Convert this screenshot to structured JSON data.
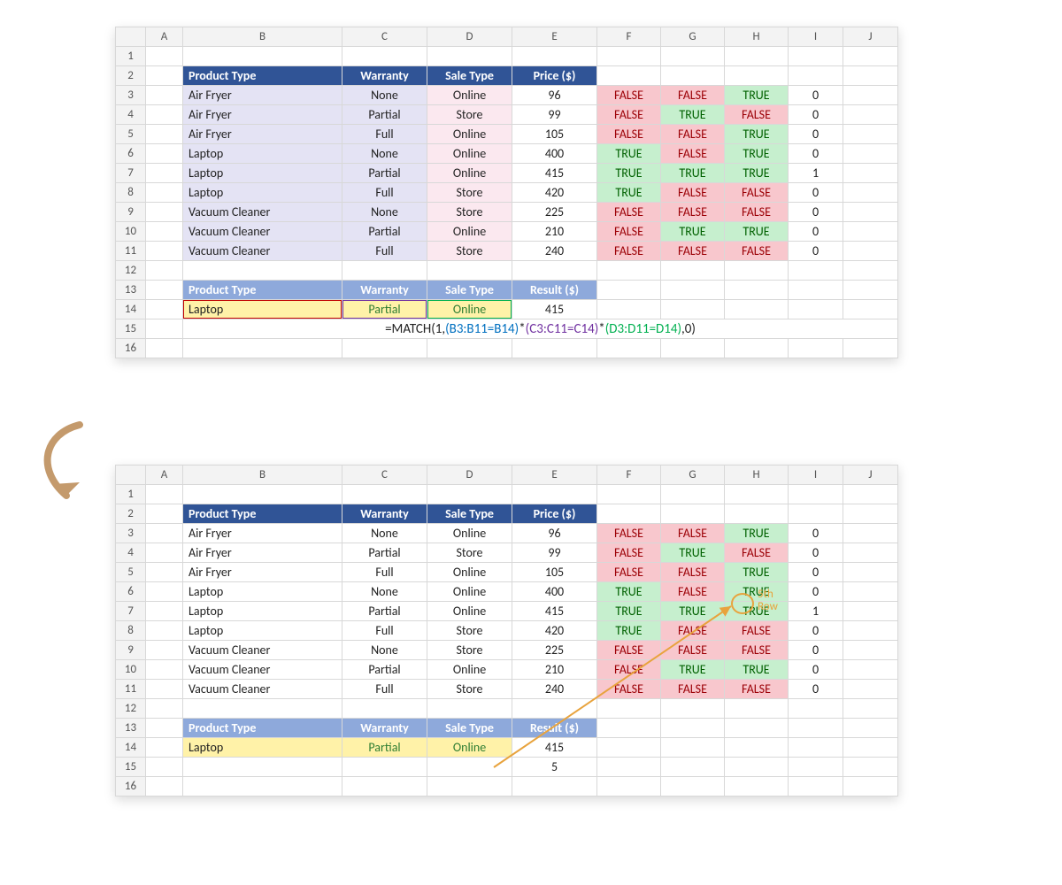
{
  "columns": [
    "A",
    "B",
    "C",
    "D",
    "E",
    "F",
    "G",
    "H",
    "I",
    "J"
  ],
  "rownums": [
    "1",
    "2",
    "3",
    "4",
    "5",
    "6",
    "7",
    "8",
    "9",
    "10",
    "11",
    "12",
    "13",
    "14",
    "15",
    "16"
  ],
  "headers": {
    "product": "Product Type",
    "warranty": "Warranty",
    "sale": "Sale Type",
    "price": "Price ($)",
    "result": "Result ($)"
  },
  "rows": [
    {
      "product": "Air Fryer",
      "warranty": "None",
      "sale": "Online",
      "price": "96",
      "f": "FALSE",
      "g": "FALSE",
      "h": "TRUE",
      "i": "0"
    },
    {
      "product": "Air Fryer",
      "warranty": "Partial",
      "sale": "Store",
      "price": "99",
      "f": "FALSE",
      "g": "TRUE",
      "h": "FALSE",
      "i": "0"
    },
    {
      "product": "Air Fryer",
      "warranty": "Full",
      "sale": "Online",
      "price": "105",
      "f": "FALSE",
      "g": "FALSE",
      "h": "TRUE",
      "i": "0"
    },
    {
      "product": "Laptop",
      "warranty": "None",
      "sale": "Online",
      "price": "400",
      "f": "TRUE",
      "g": "FALSE",
      "h": "TRUE",
      "i": "0"
    },
    {
      "product": "Laptop",
      "warranty": "Partial",
      "sale": "Online",
      "price": "415",
      "f": "TRUE",
      "g": "TRUE",
      "h": "TRUE",
      "i": "1"
    },
    {
      "product": "Laptop",
      "warranty": "Full",
      "sale": "Store",
      "price": "420",
      "f": "TRUE",
      "g": "FALSE",
      "h": "FALSE",
      "i": "0"
    },
    {
      "product": "Vacuum Cleaner",
      "warranty": "None",
      "sale": "Store",
      "price": "225",
      "f": "FALSE",
      "g": "FALSE",
      "h": "FALSE",
      "i": "0"
    },
    {
      "product": "Vacuum Cleaner",
      "warranty": "Partial",
      "sale": "Online",
      "price": "210",
      "f": "FALSE",
      "g": "TRUE",
      "h": "TRUE",
      "i": "0"
    },
    {
      "product": "Vacuum Cleaner",
      "warranty": "Full",
      "sale": "Store",
      "price": "240",
      "f": "FALSE",
      "g": "FALSE",
      "h": "FALSE",
      "i": "0"
    }
  ],
  "criteria": {
    "product": "Laptop",
    "warranty": "Partial",
    "sale": "Online",
    "result": "415"
  },
  "formula": {
    "prefix": "=MATCH(1,",
    "p1": "(B3:B11=B14)",
    "times": "*",
    "p3": "(C3:C11=C14)",
    "p4": "(D3:D11=D14)",
    "suffix": ",0)"
  },
  "result_value": "5",
  "annotation": {
    "line1": "5th",
    "line2": "Row"
  }
}
